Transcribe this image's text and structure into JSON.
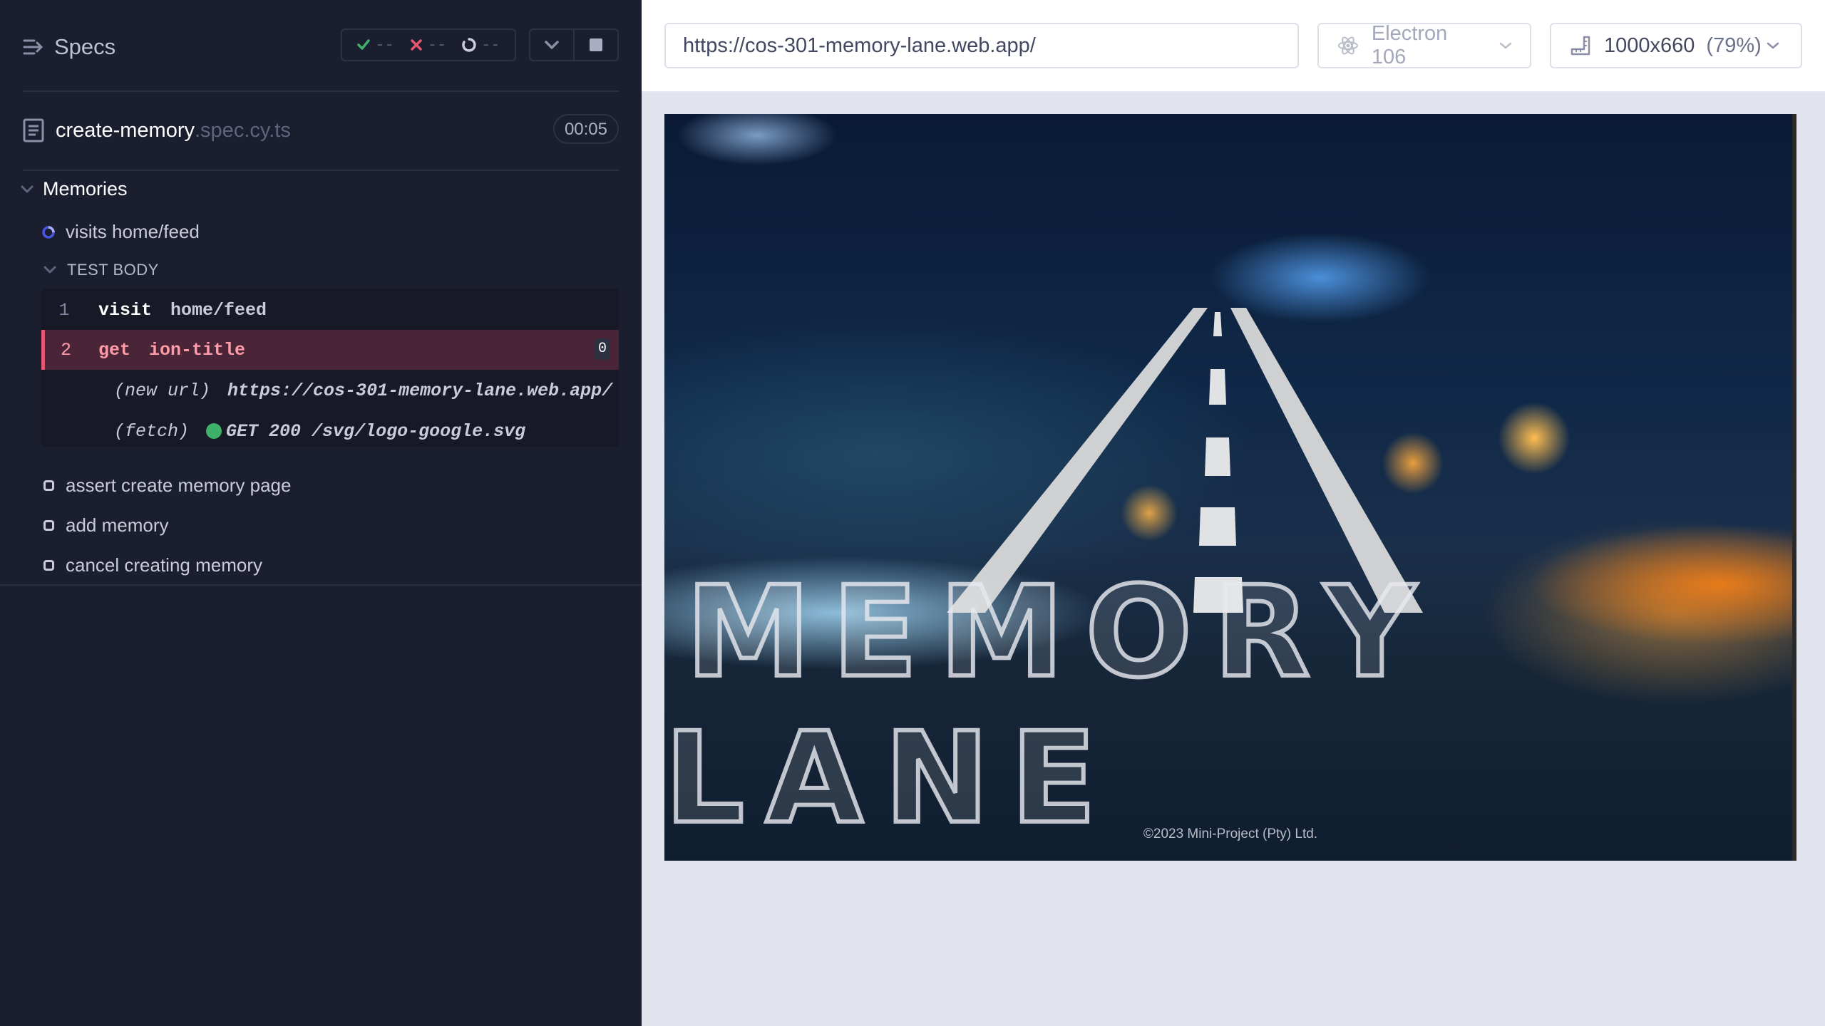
{
  "reporter": {
    "specs_title": "Specs",
    "stats": {
      "passed": "--",
      "failed": "--",
      "pending": "--"
    },
    "spec": {
      "name": "create-memory",
      "ext": ".spec.cy.ts",
      "duration": "00:05"
    },
    "suite": {
      "title": "Memories"
    },
    "tests": [
      {
        "title": "visits home/feed",
        "state": "running"
      },
      {
        "title": "assert create memory page",
        "state": "queued"
      },
      {
        "title": "add memory",
        "state": "queued"
      },
      {
        "title": "cancel creating memory",
        "state": "queued"
      }
    ],
    "test_body_label": "TEST BODY",
    "commands": [
      {
        "num": "1",
        "name": "visit",
        "message": "home/feed"
      },
      {
        "num": "2",
        "name": "get",
        "message": "ion-title",
        "badge": "0"
      }
    ],
    "events": [
      {
        "name": "(new url)",
        "message": "https://cos-301-memory-lane.web.app/"
      },
      {
        "name": "(fetch)",
        "message": "GET 200 /svg/logo-google.svg"
      }
    ]
  },
  "topbar": {
    "url": "https://cos-301-memory-lane.web.app/",
    "browser": "Electron 106",
    "viewport": "1000x660",
    "scale": "(79%)"
  },
  "app": {
    "logo_text": "MEMORY LANE",
    "copyright": "©2023 Mini-Project (Pty) Ltd."
  },
  "colors": {
    "reporter_bg": "#1b1e2e",
    "pass": "#3fb06a",
    "fail": "#e45770",
    "active_command_bg": "#4a2538"
  }
}
